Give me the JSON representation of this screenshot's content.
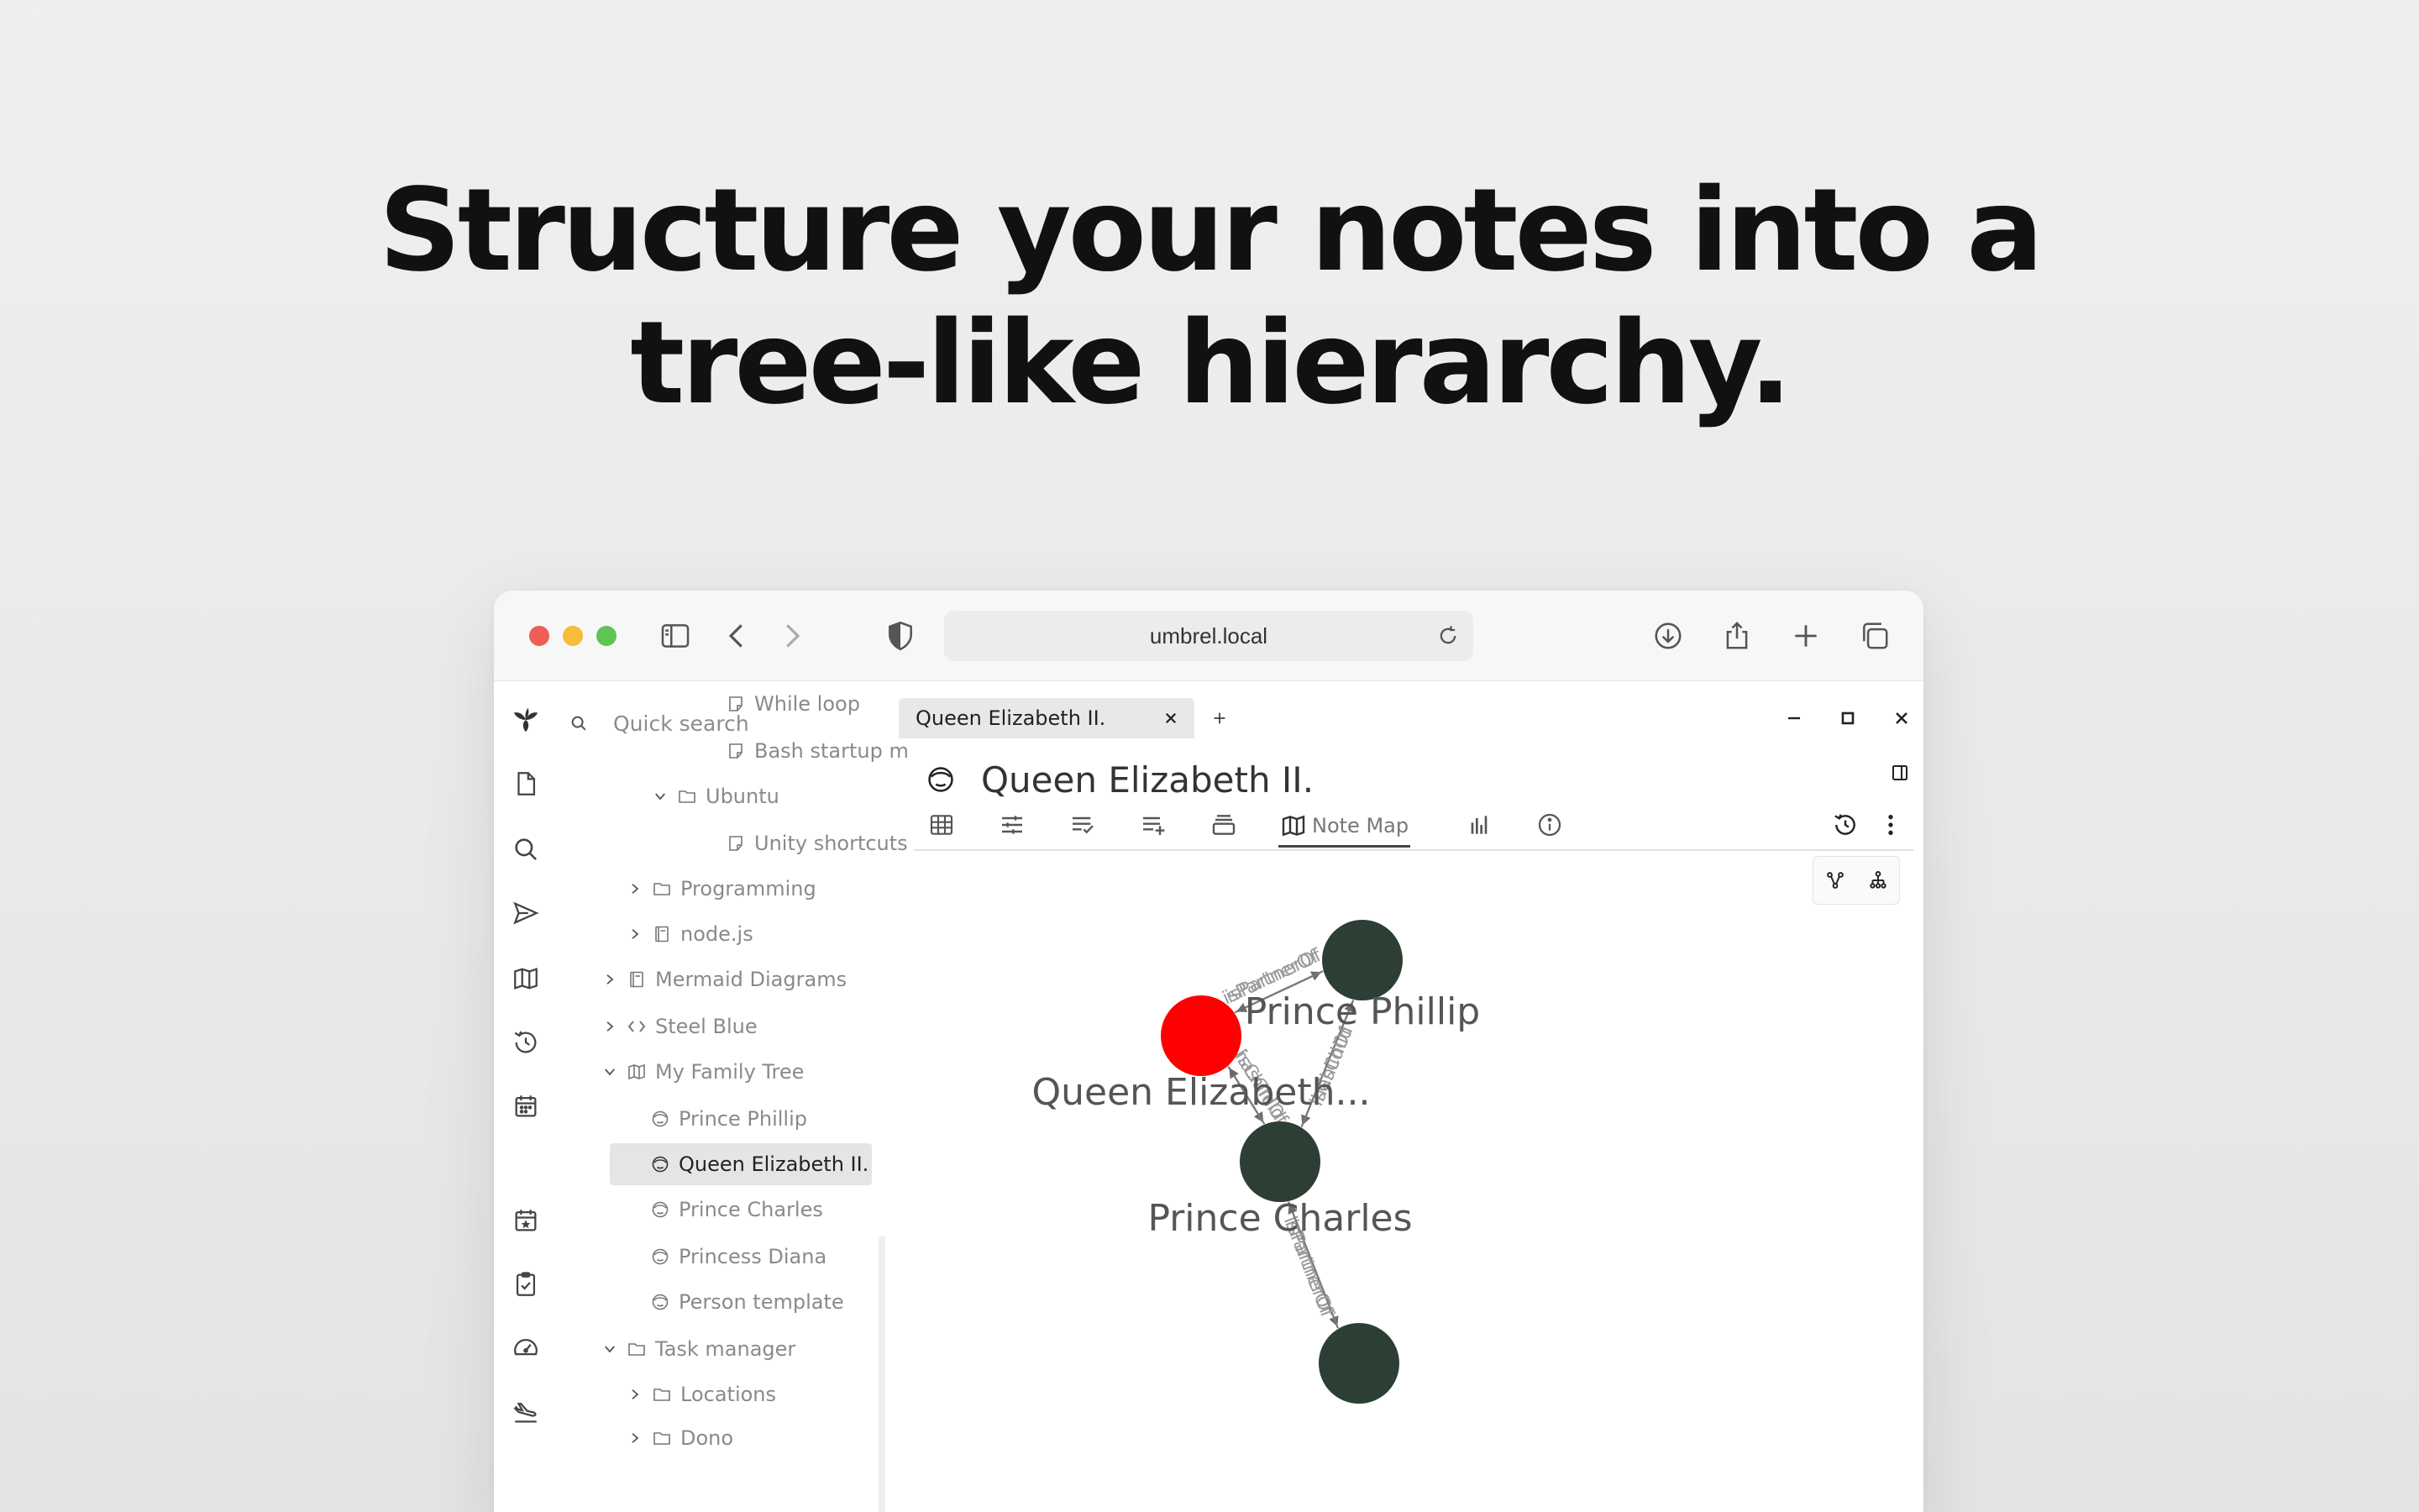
{
  "headline": {
    "line1": "Structure your notes into a",
    "line2": "tree-like hierarchy."
  },
  "browser": {
    "url": "umbrel.local"
  },
  "app": {
    "quick_search": {
      "placeholder": "Quick search"
    },
    "tree": [
      {
        "label": "While loop",
        "icon": "note-icon"
      },
      {
        "label": "Bash startup m",
        "icon": "note-icon"
      },
      {
        "label": "Ubuntu",
        "icon": "folder-icon",
        "expanded": true
      },
      {
        "label": "Unity shortcuts",
        "icon": "note-icon"
      },
      {
        "label": "Programming",
        "icon": "folder-icon",
        "expanded": false
      },
      {
        "label": "node.js",
        "icon": "book-icon",
        "expanded": false
      },
      {
        "label": "Mermaid Diagrams",
        "icon": "book-icon",
        "expanded": false
      },
      {
        "label": "Steel Blue",
        "icon": "code-icon",
        "expanded": false
      },
      {
        "label": "My Family Tree",
        "icon": "map-icon",
        "expanded": true
      },
      {
        "label": "Prince Phillip",
        "icon": "person-icon"
      },
      {
        "label": "Queen Elizabeth II.",
        "icon": "person-icon",
        "active": true
      },
      {
        "label": "Prince Charles",
        "icon": "person-icon"
      },
      {
        "label": "Princess Diana",
        "icon": "person-icon"
      },
      {
        "label": "Person template",
        "icon": "person-icon"
      },
      {
        "label": "Task manager",
        "icon": "folder-icon",
        "expanded": true
      },
      {
        "label": "Locations",
        "icon": "folder-icon",
        "expanded": false
      },
      {
        "label": "Dono",
        "icon": "folder-icon",
        "expanded": false
      }
    ],
    "tab": {
      "label": "Queen Elizabeth II."
    },
    "note": {
      "title": "Queen Elizabeth II.",
      "active_view": "Note Map"
    },
    "note_map": {
      "nodes": [
        {
          "id": "qe",
          "label": "Queen Elizabeth...",
          "color": "#ff0000"
        },
        {
          "id": "pp",
          "label": "Prince Phillip",
          "color": "#2d3e34"
        },
        {
          "id": "pc",
          "label": "Prince Charles",
          "color": "#2d3e34"
        },
        {
          "id": "pd",
          "label": "",
          "color": "#2d3e34"
        }
      ],
      "edges": [
        {
          "from": "qe",
          "to": "pp",
          "label": "isPartnerOf"
        },
        {
          "from": "pp",
          "to": "qe",
          "label": "isPartnerOf"
        },
        {
          "from": "qe",
          "to": "pc",
          "label": "hasChild"
        },
        {
          "from": "pc",
          "to": "qe",
          "label": "isChildOf"
        },
        {
          "from": "pp",
          "to": "pc",
          "label": "hasChild"
        },
        {
          "from": "pc",
          "to": "pp",
          "label": "isChildOf"
        },
        {
          "from": "pc",
          "to": "pd",
          "label": "isPartnerOf"
        },
        {
          "from": "pd",
          "to": "pc",
          "label": "isPartnerOf"
        }
      ]
    }
  },
  "colors": {
    "traffic_red": "#ee5e56",
    "traffic_yellow": "#f5bd3a",
    "traffic_green": "#5fc454",
    "active_node": "#ff0000",
    "node": "#2d3e34"
  }
}
